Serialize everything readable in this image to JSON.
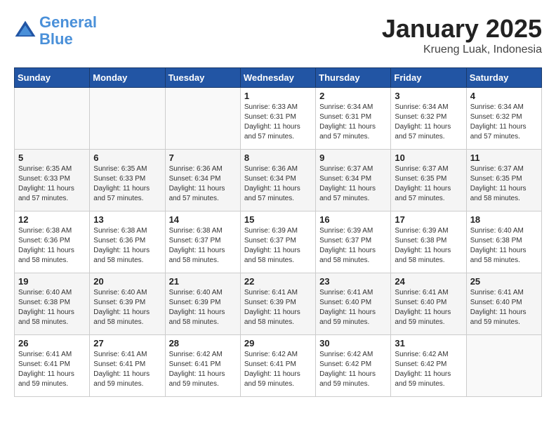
{
  "header": {
    "logo_line1": "General",
    "logo_line2": "Blue",
    "month": "January 2025",
    "location": "Krueng Luak, Indonesia"
  },
  "weekdays": [
    "Sunday",
    "Monday",
    "Tuesday",
    "Wednesday",
    "Thursday",
    "Friday",
    "Saturday"
  ],
  "weeks": [
    [
      {
        "day": "",
        "info": ""
      },
      {
        "day": "",
        "info": ""
      },
      {
        "day": "",
        "info": ""
      },
      {
        "day": "1",
        "info": "Sunrise: 6:33 AM\nSunset: 6:31 PM\nDaylight: 11 hours\nand 57 minutes."
      },
      {
        "day": "2",
        "info": "Sunrise: 6:34 AM\nSunset: 6:31 PM\nDaylight: 11 hours\nand 57 minutes."
      },
      {
        "day": "3",
        "info": "Sunrise: 6:34 AM\nSunset: 6:32 PM\nDaylight: 11 hours\nand 57 minutes."
      },
      {
        "day": "4",
        "info": "Sunrise: 6:34 AM\nSunset: 6:32 PM\nDaylight: 11 hours\nand 57 minutes."
      }
    ],
    [
      {
        "day": "5",
        "info": "Sunrise: 6:35 AM\nSunset: 6:33 PM\nDaylight: 11 hours\nand 57 minutes."
      },
      {
        "day": "6",
        "info": "Sunrise: 6:35 AM\nSunset: 6:33 PM\nDaylight: 11 hours\nand 57 minutes."
      },
      {
        "day": "7",
        "info": "Sunrise: 6:36 AM\nSunset: 6:34 PM\nDaylight: 11 hours\nand 57 minutes."
      },
      {
        "day": "8",
        "info": "Sunrise: 6:36 AM\nSunset: 6:34 PM\nDaylight: 11 hours\nand 57 minutes."
      },
      {
        "day": "9",
        "info": "Sunrise: 6:37 AM\nSunset: 6:34 PM\nDaylight: 11 hours\nand 57 minutes."
      },
      {
        "day": "10",
        "info": "Sunrise: 6:37 AM\nSunset: 6:35 PM\nDaylight: 11 hours\nand 57 minutes."
      },
      {
        "day": "11",
        "info": "Sunrise: 6:37 AM\nSunset: 6:35 PM\nDaylight: 11 hours\nand 58 minutes."
      }
    ],
    [
      {
        "day": "12",
        "info": "Sunrise: 6:38 AM\nSunset: 6:36 PM\nDaylight: 11 hours\nand 58 minutes."
      },
      {
        "day": "13",
        "info": "Sunrise: 6:38 AM\nSunset: 6:36 PM\nDaylight: 11 hours\nand 58 minutes."
      },
      {
        "day": "14",
        "info": "Sunrise: 6:38 AM\nSunset: 6:37 PM\nDaylight: 11 hours\nand 58 minutes."
      },
      {
        "day": "15",
        "info": "Sunrise: 6:39 AM\nSunset: 6:37 PM\nDaylight: 11 hours\nand 58 minutes."
      },
      {
        "day": "16",
        "info": "Sunrise: 6:39 AM\nSunset: 6:37 PM\nDaylight: 11 hours\nand 58 minutes."
      },
      {
        "day": "17",
        "info": "Sunrise: 6:39 AM\nSunset: 6:38 PM\nDaylight: 11 hours\nand 58 minutes."
      },
      {
        "day": "18",
        "info": "Sunrise: 6:40 AM\nSunset: 6:38 PM\nDaylight: 11 hours\nand 58 minutes."
      }
    ],
    [
      {
        "day": "19",
        "info": "Sunrise: 6:40 AM\nSunset: 6:38 PM\nDaylight: 11 hours\nand 58 minutes."
      },
      {
        "day": "20",
        "info": "Sunrise: 6:40 AM\nSunset: 6:39 PM\nDaylight: 11 hours\nand 58 minutes."
      },
      {
        "day": "21",
        "info": "Sunrise: 6:40 AM\nSunset: 6:39 PM\nDaylight: 11 hours\nand 58 minutes."
      },
      {
        "day": "22",
        "info": "Sunrise: 6:41 AM\nSunset: 6:39 PM\nDaylight: 11 hours\nand 58 minutes."
      },
      {
        "day": "23",
        "info": "Sunrise: 6:41 AM\nSunset: 6:40 PM\nDaylight: 11 hours\nand 59 minutes."
      },
      {
        "day": "24",
        "info": "Sunrise: 6:41 AM\nSunset: 6:40 PM\nDaylight: 11 hours\nand 59 minutes."
      },
      {
        "day": "25",
        "info": "Sunrise: 6:41 AM\nSunset: 6:40 PM\nDaylight: 11 hours\nand 59 minutes."
      }
    ],
    [
      {
        "day": "26",
        "info": "Sunrise: 6:41 AM\nSunset: 6:41 PM\nDaylight: 11 hours\nand 59 minutes."
      },
      {
        "day": "27",
        "info": "Sunrise: 6:41 AM\nSunset: 6:41 PM\nDaylight: 11 hours\nand 59 minutes."
      },
      {
        "day": "28",
        "info": "Sunrise: 6:42 AM\nSunset: 6:41 PM\nDaylight: 11 hours\nand 59 minutes."
      },
      {
        "day": "29",
        "info": "Sunrise: 6:42 AM\nSunset: 6:41 PM\nDaylight: 11 hours\nand 59 minutes."
      },
      {
        "day": "30",
        "info": "Sunrise: 6:42 AM\nSunset: 6:42 PM\nDaylight: 11 hours\nand 59 minutes."
      },
      {
        "day": "31",
        "info": "Sunrise: 6:42 AM\nSunset: 6:42 PM\nDaylight: 11 hours\nand 59 minutes."
      },
      {
        "day": "",
        "info": ""
      }
    ]
  ]
}
